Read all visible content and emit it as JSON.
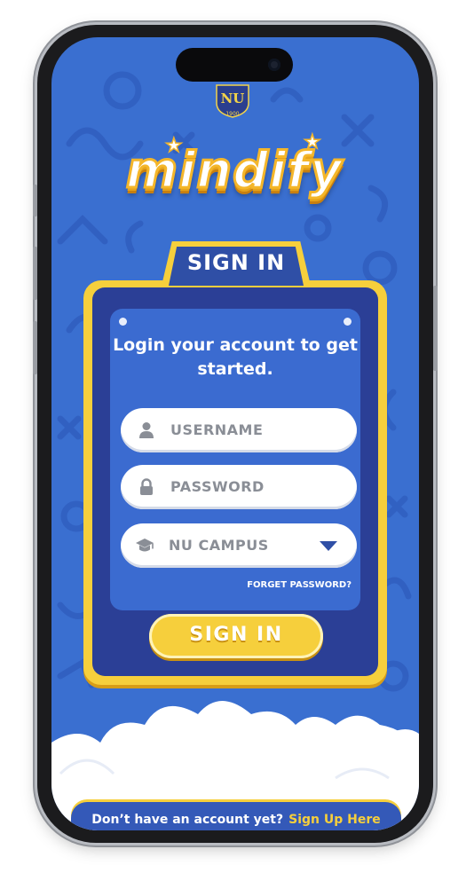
{
  "header": {
    "seal_year": "1900",
    "logo_text": "mindify"
  },
  "login": {
    "tab_label": "SIGN IN",
    "headline": "Login your account to get started.",
    "username_placeholder": "USERNAME",
    "password_placeholder": "PASSWORD",
    "campus_selected": "NU CAMPUS",
    "forgot_link": "FORGET PASSWORD?",
    "signin_button": "SIGN IN"
  },
  "footer": {
    "prompt": "Don’t have an account yet?",
    "signup_link": "Sign Up Here"
  },
  "icons": {
    "username": "user-icon",
    "password": "lock-icon",
    "campus": "graduation-cap-icon",
    "dropdown": "caret-down-icon"
  },
  "colors": {
    "background_blue": "#3a6fd0",
    "accent_yellow": "#f6cf3c",
    "panel_dark": "#2b3f96"
  }
}
